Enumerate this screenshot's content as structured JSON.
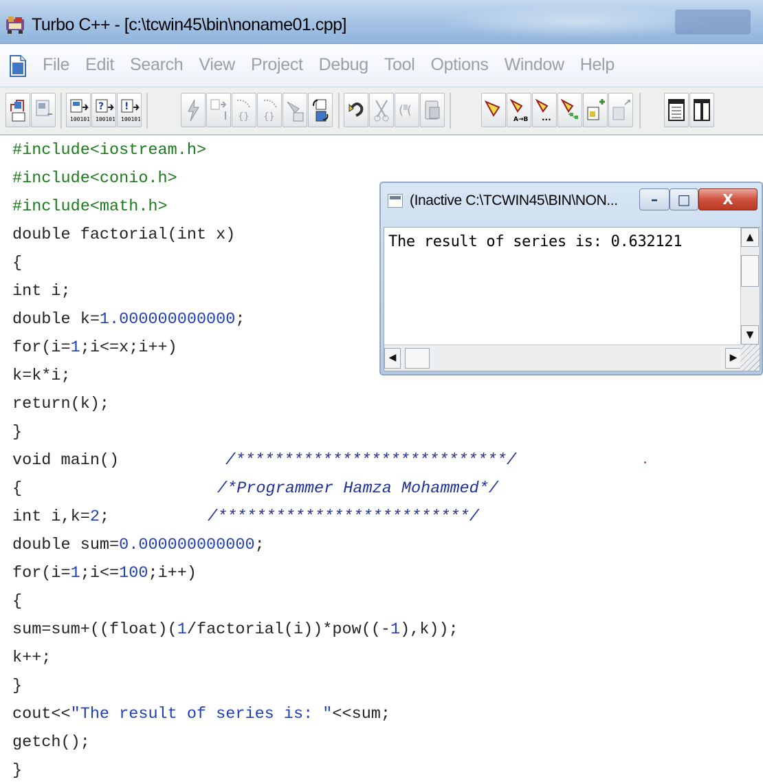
{
  "window": {
    "title": "Turbo C++ - [c:\\tcwin45\\bin\\noname01.cpp]"
  },
  "menu": {
    "items": [
      "File",
      "Edit",
      "Search",
      "View",
      "Project",
      "Debug",
      "Tool",
      "Options",
      "Window",
      "Help"
    ]
  },
  "toolbar": {
    "icons": [
      "open-file-icon",
      "save-file-icon",
      "compile-icon",
      "make-icon",
      "build-icon",
      "lightning-icon",
      "step-into-icon",
      "run-to-cursor-icon",
      "brace-icon",
      "inspect-icon",
      "transfer-icon",
      "undo-icon",
      "cut-icon",
      "copy-icon",
      "paste-icon",
      "search-icon",
      "replace-icon",
      "search-again-icon",
      "browse-icon",
      "new-window-icon",
      "close-window-icon",
      "tile-icon",
      "cascade-icon"
    ]
  },
  "code": {
    "lines": [
      "#include<iostream.h>",
      "#include<conio.h>",
      "#include<math.h>",
      "double factorial(int x)",
      "{",
      "int i;",
      "double k=1.000000000000;",
      "for(i=1;i<=x;i++)",
      "k=k*i;",
      "return(k);",
      "}",
      "void main()",
      "{",
      "int i,k=2;",
      "double sum=0.000000000000;",
      "for(i=1;i<=100;i++)",
      "{",
      "sum=sum+((float)(1/factorial(i))*pow((-1),k));",
      "k++;",
      "}",
      "cout<<\"The result of series is: \"<<sum;",
      "getch();",
      "}"
    ],
    "comments": [
      "/****************************/",
      "/*Programmer Hamza Mohammed*/",
      "/**************************/"
    ]
  },
  "console": {
    "title": "(Inactive C:\\TCWIN45\\BIN\\NON...",
    "output": "The result of series is: 0.632121",
    "minimize_glyph": "–",
    "maximize_glyph": "□",
    "close_glyph": "X"
  },
  "colors": {
    "titlebar": "#a9c6e6",
    "preprocessor": "#1b7a1b",
    "number_and_string": "#1f3fb4",
    "comment": "#1f2f9a",
    "close_button": "#d0513d"
  }
}
